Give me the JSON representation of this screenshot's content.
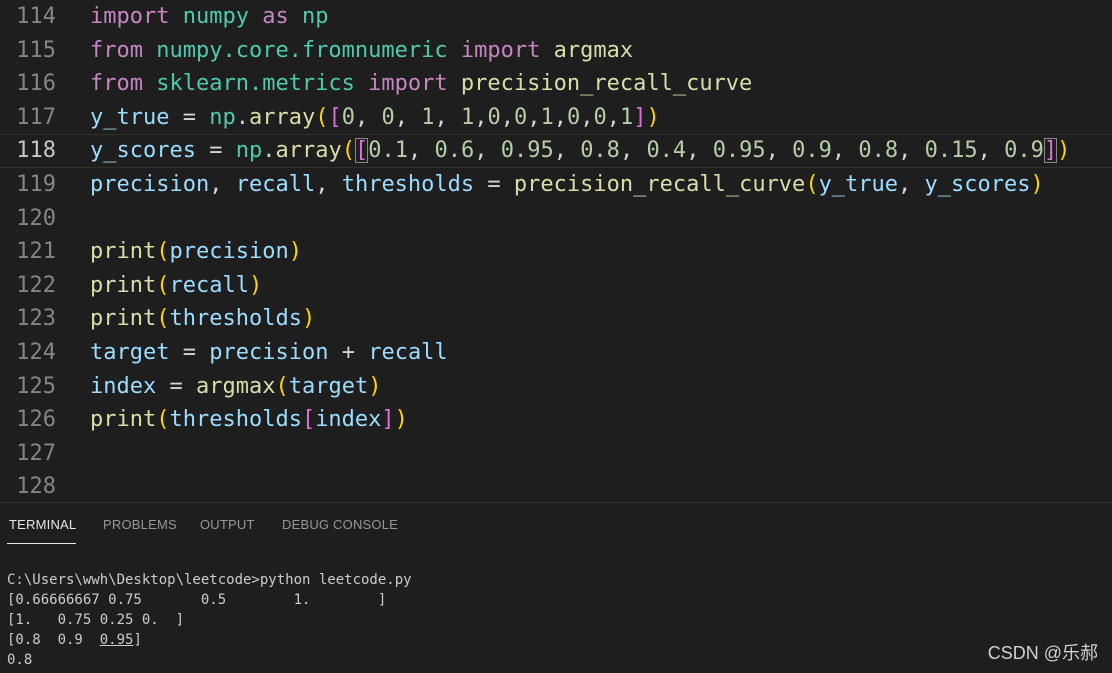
{
  "editor": {
    "current_line": "118",
    "lines": [
      {
        "number": "114",
        "tokens": [
          [
            "kw",
            "import"
          ],
          [
            "op",
            " "
          ],
          [
            "mod",
            "numpy"
          ],
          [
            "op",
            " "
          ],
          [
            "kw",
            "as"
          ],
          [
            "op",
            " "
          ],
          [
            "mod",
            "np"
          ]
        ]
      },
      {
        "number": "115",
        "tokens": [
          [
            "kw",
            "from"
          ],
          [
            "op",
            " "
          ],
          [
            "mod",
            "numpy.core.fromnumeric"
          ],
          [
            "op",
            " "
          ],
          [
            "kw",
            "import"
          ],
          [
            "op",
            " "
          ],
          [
            "fn",
            "argmax"
          ]
        ]
      },
      {
        "number": "116",
        "tokens": [
          [
            "kw",
            "from"
          ],
          [
            "op",
            " "
          ],
          [
            "mod",
            "sklearn.metrics"
          ],
          [
            "op",
            " "
          ],
          [
            "kw",
            "import"
          ],
          [
            "op",
            " "
          ],
          [
            "fn",
            "precision_recall_curve"
          ]
        ]
      },
      {
        "number": "117",
        "tokens": [
          [
            "var",
            "y_true"
          ],
          [
            "op",
            " = "
          ],
          [
            "mod",
            "np"
          ],
          [
            "op",
            "."
          ],
          [
            "fn",
            "array"
          ],
          [
            "br",
            "("
          ],
          [
            "br2",
            "["
          ],
          [
            "num",
            "0"
          ],
          [
            "op",
            ", "
          ],
          [
            "num",
            "0"
          ],
          [
            "op",
            ", "
          ],
          [
            "num",
            "1"
          ],
          [
            "op",
            ", "
          ],
          [
            "num",
            "1"
          ],
          [
            "op",
            ","
          ],
          [
            "num",
            "0"
          ],
          [
            "op",
            ","
          ],
          [
            "num",
            "0"
          ],
          [
            "op",
            ","
          ],
          [
            "num",
            "1"
          ],
          [
            "op",
            ","
          ],
          [
            "num",
            "0"
          ],
          [
            "op",
            ","
          ],
          [
            "num",
            "0"
          ],
          [
            "op",
            ","
          ],
          [
            "num",
            "1"
          ],
          [
            "br2",
            "]"
          ],
          [
            "br",
            ")"
          ]
        ]
      },
      {
        "number": "118",
        "tokens": [
          [
            "var",
            "y_scores"
          ],
          [
            "op",
            " = "
          ],
          [
            "mod",
            "np"
          ],
          [
            "op",
            "."
          ],
          [
            "fn",
            "array"
          ],
          [
            "br",
            "("
          ],
          [
            "br2m",
            "["
          ],
          [
            "num",
            "0.1"
          ],
          [
            "op",
            ", "
          ],
          [
            "num",
            "0.6"
          ],
          [
            "op",
            ", "
          ],
          [
            "num",
            "0.95"
          ],
          [
            "op",
            ", "
          ],
          [
            "num",
            "0.8"
          ],
          [
            "op",
            ", "
          ],
          [
            "num",
            "0.4"
          ],
          [
            "op",
            ", "
          ],
          [
            "num",
            "0.95"
          ],
          [
            "op",
            ", "
          ],
          [
            "num",
            "0.9"
          ],
          [
            "op",
            ", "
          ],
          [
            "num",
            "0.8"
          ],
          [
            "op",
            ", "
          ],
          [
            "num",
            "0.15"
          ],
          [
            "op",
            ", "
          ],
          [
            "num",
            "0.9"
          ],
          [
            "br2m",
            "]"
          ],
          [
            "br",
            ")"
          ]
        ]
      },
      {
        "number": "119",
        "tokens": [
          [
            "var",
            "precision"
          ],
          [
            "op",
            ", "
          ],
          [
            "var",
            "recall"
          ],
          [
            "op",
            ", "
          ],
          [
            "var",
            "thresholds"
          ],
          [
            "op",
            " = "
          ],
          [
            "fn",
            "precision_recall_curve"
          ],
          [
            "br",
            "("
          ],
          [
            "var",
            "y_true"
          ],
          [
            "op",
            ", "
          ],
          [
            "var",
            "y_scores"
          ],
          [
            "br",
            ")"
          ]
        ]
      },
      {
        "number": "120",
        "tokens": []
      },
      {
        "number": "121",
        "tokens": [
          [
            "fn",
            "print"
          ],
          [
            "br",
            "("
          ],
          [
            "var",
            "precision"
          ],
          [
            "br",
            ")"
          ]
        ]
      },
      {
        "number": "122",
        "tokens": [
          [
            "fn",
            "print"
          ],
          [
            "br",
            "("
          ],
          [
            "var",
            "recall"
          ],
          [
            "br",
            ")"
          ]
        ]
      },
      {
        "number": "123",
        "tokens": [
          [
            "fn",
            "print"
          ],
          [
            "br",
            "("
          ],
          [
            "var",
            "thresholds"
          ],
          [
            "br",
            ")"
          ]
        ]
      },
      {
        "number": "124",
        "tokens": [
          [
            "var",
            "target"
          ],
          [
            "op",
            " = "
          ],
          [
            "var",
            "precision"
          ],
          [
            "op",
            " + "
          ],
          [
            "var",
            "recall"
          ]
        ]
      },
      {
        "number": "125",
        "tokens": [
          [
            "var",
            "index"
          ],
          [
            "op",
            " = "
          ],
          [
            "fn",
            "argmax"
          ],
          [
            "br",
            "("
          ],
          [
            "var",
            "target"
          ],
          [
            "br",
            ")"
          ]
        ]
      },
      {
        "number": "126",
        "tokens": [
          [
            "fn",
            "print"
          ],
          [
            "br",
            "("
          ],
          [
            "var",
            "thresholds"
          ],
          [
            "br2",
            "["
          ],
          [
            "var",
            "index"
          ],
          [
            "br2",
            "]"
          ],
          [
            "br",
            ")"
          ]
        ]
      },
      {
        "number": "127",
        "tokens": []
      },
      {
        "number": "128",
        "tokens": []
      }
    ]
  },
  "panel": {
    "tabs": [
      {
        "label": "TERMINAL",
        "active": true
      },
      {
        "label": "PROBLEMS",
        "active": false
      },
      {
        "label": "OUTPUT",
        "active": false
      },
      {
        "label": "DEBUG CONSOLE",
        "active": false
      }
    ],
    "terminal": {
      "command_line": "C:\\Users\\wwh\\Desktop\\leetcode>python leetcode.py",
      "output_1": "[0.66666667 0.75       0.5        1.        ]",
      "output_2": "[1.   0.75 0.25 0.  ]",
      "output_3_prefix": "[0.8  0.9  ",
      "output_3_underlined": "0.95",
      "output_3_suffix": "]",
      "output_4": "0.8"
    }
  },
  "watermark": "CSDN @乐郝",
  "colors": {
    "background": "#1e1e1e",
    "keyword": "#c586c0",
    "variable": "#9cdcfe",
    "module": "#4ec9b0",
    "function": "#dcdcaa",
    "number": "#b5cea8",
    "bracket_level1": "#ffd700",
    "bracket_level2": "#da70d6"
  }
}
